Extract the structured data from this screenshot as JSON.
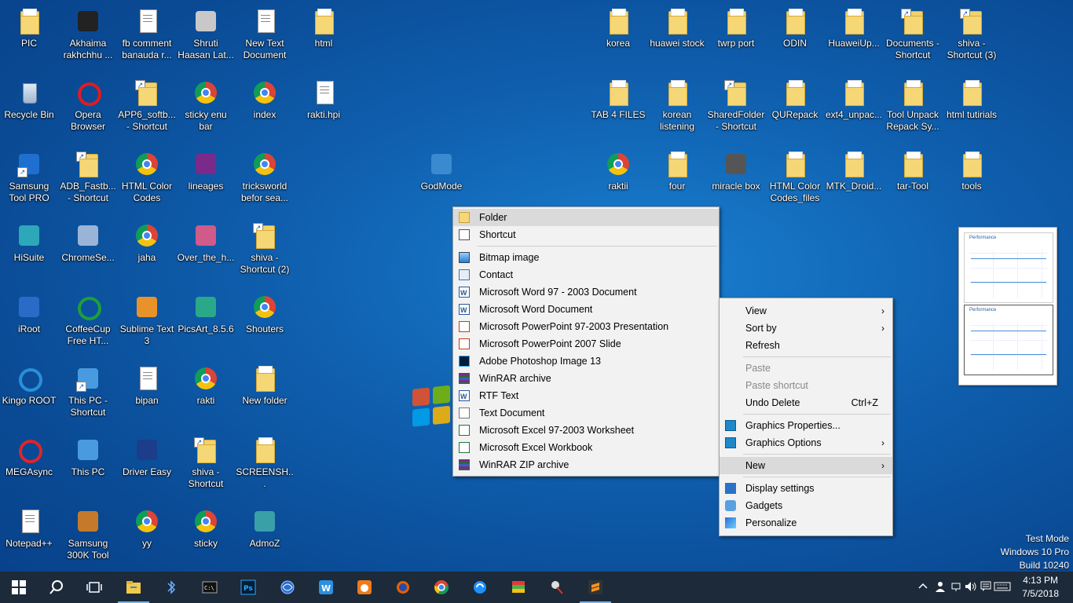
{
  "desktop": {
    "icons": {
      "pic": "PIC",
      "akhaima": "Akhaima rakhchhu ...",
      "fbcomment": "fb comment banauda r...",
      "shruti": "Shruti Haasan Lat...",
      "newtext": "New Text Document",
      "html": "html",
      "korea": "korea",
      "huawei": "huawei stock",
      "twrp": "twrp port",
      "odin": "ODIN",
      "huaweiup": "HuaweiUp...",
      "docshort": "Documents - Shortcut",
      "shiva3": "shiva - Shortcut (3)",
      "recycle": "Recycle Bin",
      "opera": "Opera Browser",
      "app6": "APP6_softb... - Shortcut",
      "stickyenu": "sticky enu bar",
      "index": "index",
      "rakti_hpi": "rakti.hpi",
      "tab4": "TAB 4 FILES",
      "korean": "korean listening",
      "sharedfolder": "SharedFolder - Shortcut",
      "qurepack": "QURepack",
      "ext4": "ext4_unpac...",
      "toolunpack": "Tool Unpack Repack Sy...",
      "htmltut": "html tutirials",
      "samsungpro": "Samsung Tool PRO",
      "adbfast": "ADB_Fastb... - Shortcut",
      "htmlcolor": "HTML Color Codes",
      "lineages": "lineages",
      "tricksworld": "tricksworld befor sea...",
      "godmode": "GodMode",
      "raktii": "raktii",
      "four": "four",
      "miraclebox": "miracle box",
      "htmlcolorfiles": "HTML Color Codes_files",
      "mtkdroid": "MTK_Droid...",
      "tartool": "tar-Tool",
      "tools": "tools",
      "hisuite": "HiSuite",
      "chromese": "ChromeSe...",
      "jaha": "jaha",
      "overthe": "Over_the_h...",
      "shiva2": "shiva - Shortcut (2)",
      "iroot": "iRoot",
      "coffeecup": "CoffeeCup Free HT...",
      "sublime": "Sublime Text 3",
      "picsart": "PicsArt_8.5.6",
      "shouters": "Shouters",
      "kingo": "Kingo ROOT",
      "thispcshort": "This PC - Shortcut",
      "bipan": "bipan",
      "rakti": "rakti",
      "newfolder": "New folder",
      "mega": "MEGAsync",
      "thispc": "This PC",
      "drivereasy": "Driver Easy",
      "shivashort": "shiva - Shortcut",
      "screensh": "SCREENSH...",
      "notepadpp": "Notepad++",
      "samsung300": "Samsung 300K Tool",
      "yy": "yy",
      "sticky": "sticky",
      "admoz": "AdmoZ"
    }
  },
  "new_submenu": {
    "items": [
      "Folder",
      "Shortcut",
      "Bitmap image",
      "Contact",
      "Microsoft Word 97 - 2003 Document",
      "Microsoft Word Document",
      "Microsoft PowerPoint 97-2003 Presentation",
      "Microsoft PowerPoint 2007 Slide",
      "Adobe Photoshop Image 13",
      "WinRAR archive",
      "RTF Text",
      "Text Document",
      "Microsoft Excel 97-2003 Worksheet",
      "Microsoft Excel Workbook",
      "WinRAR ZIP archive"
    ]
  },
  "context_menu": {
    "view": "View",
    "sort_by": "Sort by",
    "refresh": "Refresh",
    "paste": "Paste",
    "paste_shortcut": "Paste shortcut",
    "undo_delete": "Undo Delete",
    "undo_accel": "Ctrl+Z",
    "graphics_properties": "Graphics Properties...",
    "graphics_options": "Graphics Options",
    "new": "New",
    "display_settings": "Display settings",
    "gadgets": "Gadgets",
    "personalize": "Personalize",
    "arrow": "›"
  },
  "gadget": {
    "title": "Performance"
  },
  "watermark": {
    "line1": "Test Mode",
    "line2": "Windows 10 Pro",
    "line3": "Build 10240"
  },
  "taskbar": {
    "time": "4:13 PM",
    "date": "7/5/2018"
  },
  "colors": {
    "accent": "#0f5fae",
    "taskbar": "#1c2a3a",
    "menu_bg": "#f2f2f2"
  }
}
